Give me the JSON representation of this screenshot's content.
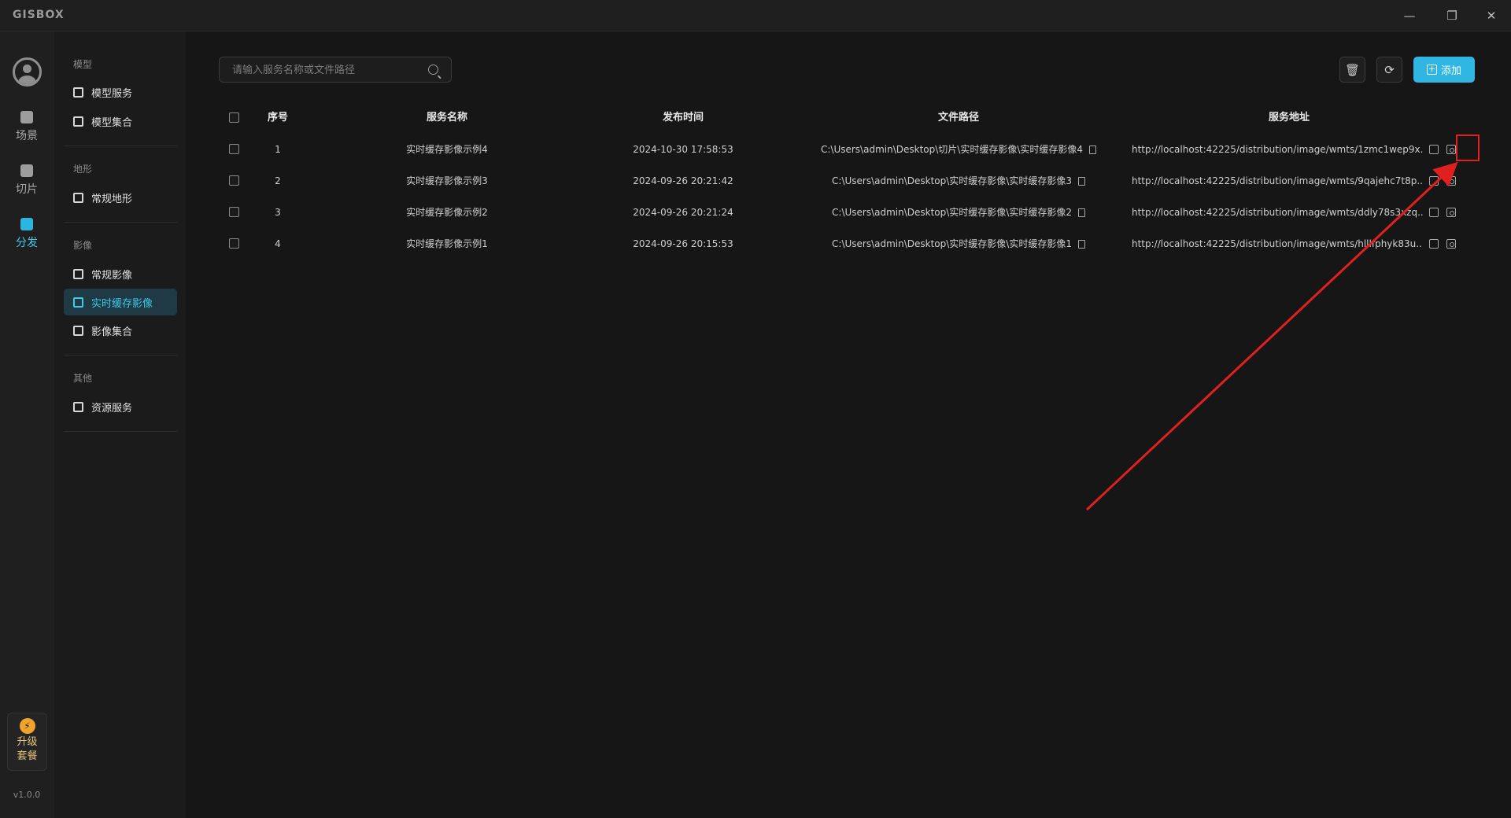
{
  "app": {
    "logo": "GISBOX"
  },
  "window": {
    "min_icon": "—",
    "restore_icon": "❐",
    "close_icon": "✕"
  },
  "rail": {
    "items": [
      {
        "label": "场景"
      },
      {
        "label": "切片"
      },
      {
        "label": "分发"
      }
    ],
    "upgrade": {
      "icon": "⚡",
      "line1": "升级",
      "line2": "套餐"
    },
    "version": "v1.0.0"
  },
  "sidenav": {
    "groups": [
      {
        "title": "模型",
        "items": [
          "模型服务",
          "模型集合"
        ]
      },
      {
        "title": "地形",
        "items": [
          "常规地形"
        ]
      },
      {
        "title": "影像",
        "items": [
          "常规影像",
          "实时缓存影像",
          "影像集合"
        ]
      },
      {
        "title": "其他",
        "items": [
          "资源服务"
        ]
      }
    ],
    "active_item": "实时缓存影像"
  },
  "toolbar": {
    "search_placeholder": "请输入服务名称或文件路径",
    "add_label": "添加",
    "delete_icon": "trash-icon",
    "refresh_icon": "refresh-icon"
  },
  "table": {
    "headers": [
      "序号",
      "服务名称",
      "发布时间",
      "文件路径",
      "服务地址"
    ],
    "rows": [
      {
        "index": "1",
        "name": "实时缓存影像示例4",
        "time": "2024-10-30 17:58:53",
        "path": "C:\\Users\\admin\\Desktop\\切片\\实时缓存影像\\实时缓存影像4",
        "url": "http://localhost:42225/distribution/image/wmts/1zmc1wep9x..."
      },
      {
        "index": "2",
        "name": "实时缓存影像示例3",
        "time": "2024-09-26 20:21:42",
        "path": "C:\\Users\\admin\\Desktop\\实时缓存影像\\实时缓存影像3",
        "url": "http://localhost:42225/distribution/image/wmts/9qajehc7t8p..."
      },
      {
        "index": "3",
        "name": "实时缓存影像示例2",
        "time": "2024-09-26 20:21:24",
        "path": "C:\\Users\\admin\\Desktop\\实时缓存影像\\实时缓存影像2",
        "url": "http://localhost:42225/distribution/image/wmts/ddly78s3xzq..."
      },
      {
        "index": "4",
        "name": "实时缓存影像示例1",
        "time": "2024-09-26 20:15:53",
        "path": "C:\\Users\\admin\\Desktop\\实时缓存影像\\实时缓存影像1",
        "url": "http://localhost:42225/distribution/image/wmts/hlllfphyk83u..."
      }
    ]
  },
  "colors": {
    "accent": "#2fb6e2",
    "annotation": "#e0201f"
  }
}
